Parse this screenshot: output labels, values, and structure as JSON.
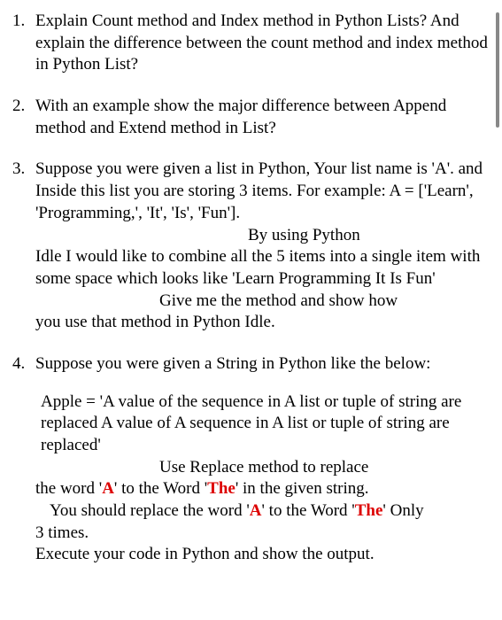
{
  "questions": [
    {
      "lines": [
        "Explain Count method and Index method in Python Lists? And explain the difference between the count method and index method in Python List?"
      ]
    },
    {
      "lines": [
        "With an example show the major difference between Append method and Extend method in List?"
      ]
    },
    {
      "l1": "Suppose you were given a list in Python, Your list name is 'A'. and Inside this list you are storing 3 items. For example: A = ['Learn', 'Programming,', 'It', 'Is', 'Fun'].",
      "l2": "By using Python",
      "l3": "Idle I would like to combine all the 5 items into a single item with some space which looks like 'Learn Programming It Is Fun'",
      "l4": "Give me the method and show how",
      "l5": "you use that method in Python Idle."
    },
    {
      "l1": "Suppose you were given a String in Python like the below:",
      "l2": " Apple = 'A value of the sequence in A list or tuple of string are replaced A value of A sequence in A list or tuple of string are replaced'",
      "l3a": "Use Replace method to replace",
      "l3b_pre": "the word '",
      "l3b_a": "A",
      "l3b_mid": "' to the Word '",
      "l3b_the": "The",
      "l3b_post": "' in the given string.",
      "l4_pre": "You should replace the word '",
      "l4_a": "A",
      "l4_mid": "' to the Word '",
      "l4_the": "The",
      "l4_post": "' Only",
      "l5": "3 times.",
      "l6": "Execute your code in Python and show the output."
    }
  ]
}
